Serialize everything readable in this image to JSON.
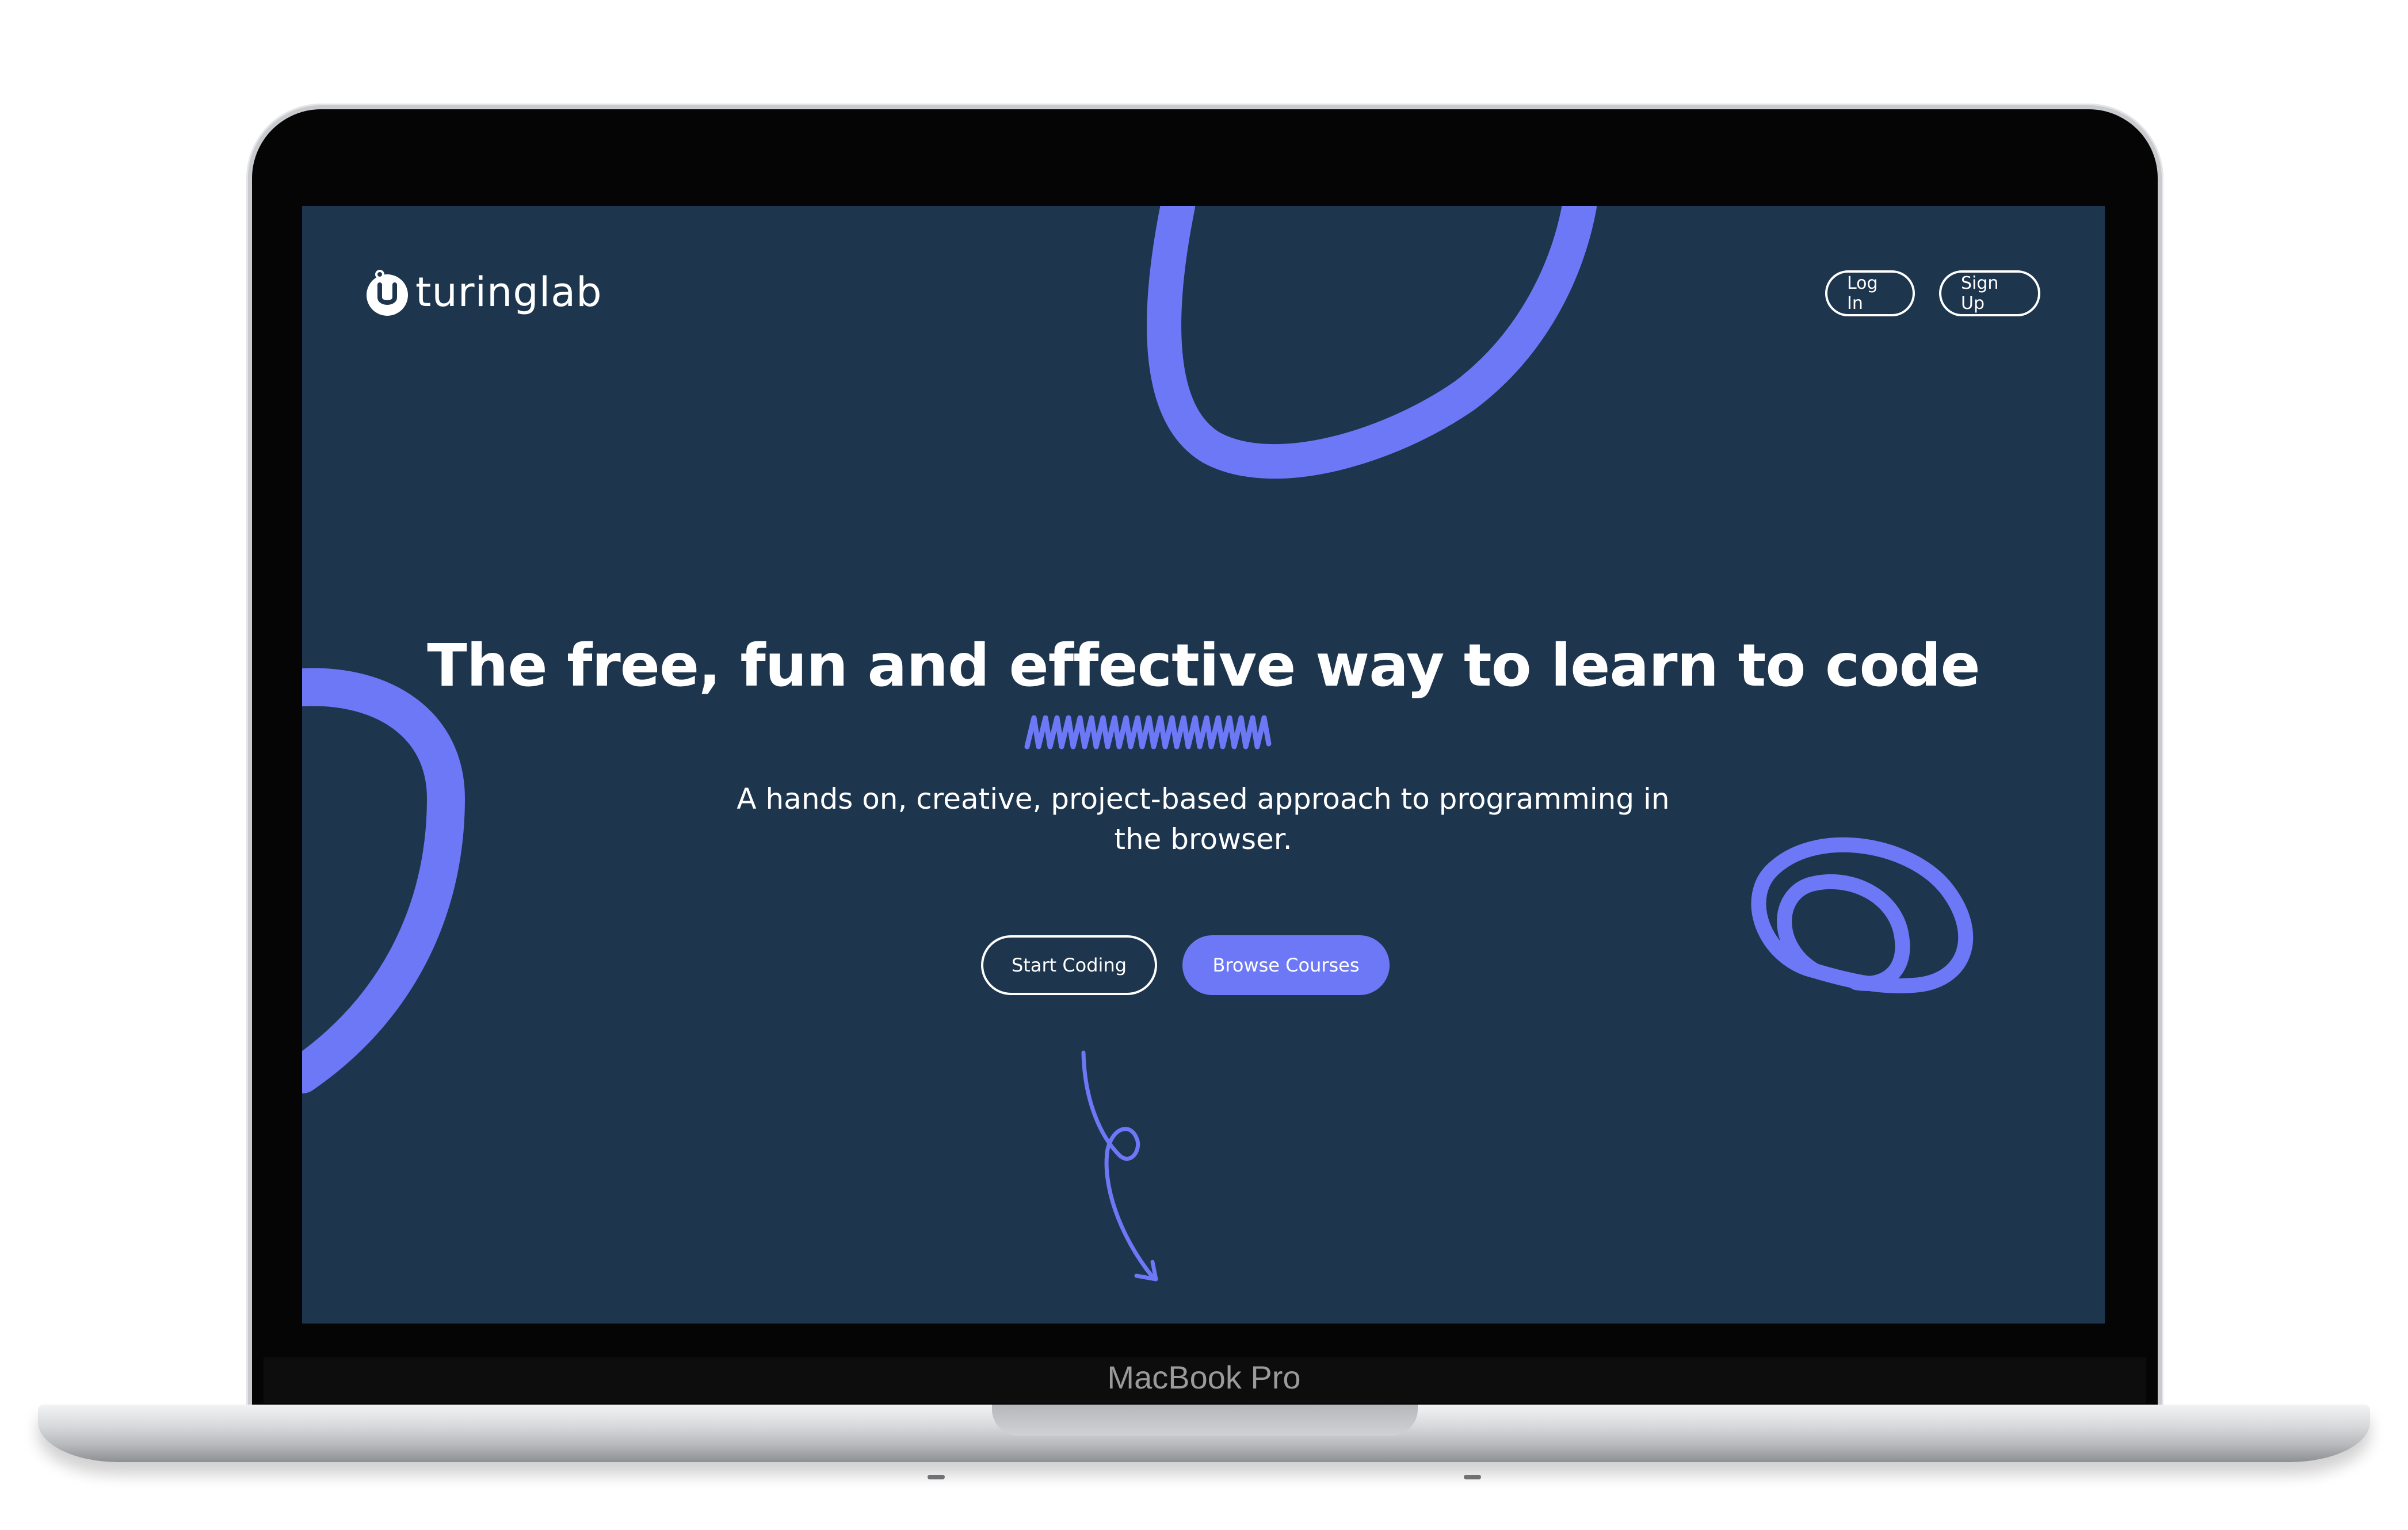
{
  "device": {
    "label": "MacBook Pro"
  },
  "header": {
    "brand": "turinglab",
    "login_label": "Log In",
    "signup_label": "Sign Up"
  },
  "hero": {
    "headline": "The free, fun and effective way to learn to code",
    "subheadline": "A hands on, creative, project-based approach to programming in the browser.",
    "primary_cta": "Start Coding",
    "secondary_cta": "Browse Courses"
  },
  "icons": [
    "turinglab-logo-icon",
    "scroll-down-arrow-icon"
  ],
  "colors": {
    "background": "#1e354e",
    "accent": "#6d78f7",
    "text": "#ffffff"
  }
}
